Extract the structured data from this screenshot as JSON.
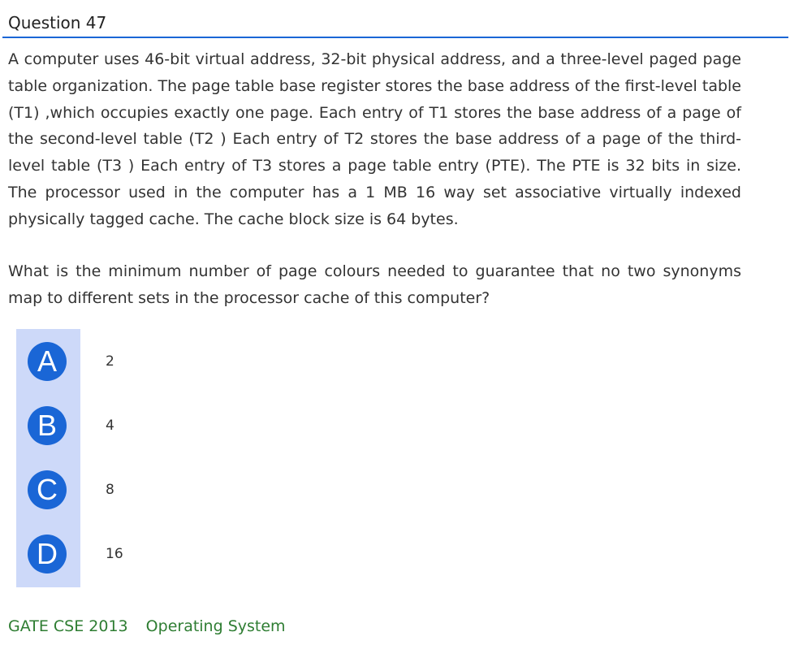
{
  "question": {
    "title": "Question 47",
    "body": "A computer uses 46-bit virtual address, 32-bit physical address, and a three-level paged page table organization. The page table base register stores the base address of the first-level table (T1) ,which occupies exactly one page. Each entry of T1 stores the base address of a page of the second-level table (T2 ) Each entry of T2 stores the base address of a page of the third-level table (T3 ) Each entry of T3 stores a page table entry (PTE). The PTE is 32 bits in size. The processor used in the computer has a 1 MB 16 way set associative virtually indexed physically tagged cache. The cache block size is 64 bytes.",
    "prompt": "What is the minimum number of page colours needed to guarantee that no two synonyms map to different sets in the processor cache of this computer?"
  },
  "options": [
    {
      "letter": "A",
      "value": "2"
    },
    {
      "letter": "B",
      "value": "4"
    },
    {
      "letter": "C",
      "value": "8"
    },
    {
      "letter": "D",
      "value": "16"
    }
  ],
  "tags": {
    "exam": "GATE CSE 2013",
    "topic": "Operating System"
  },
  "colors": {
    "accent": "#1a66d6",
    "options_background": "#cdd9f9",
    "tag_text": "#2e7d32"
  }
}
